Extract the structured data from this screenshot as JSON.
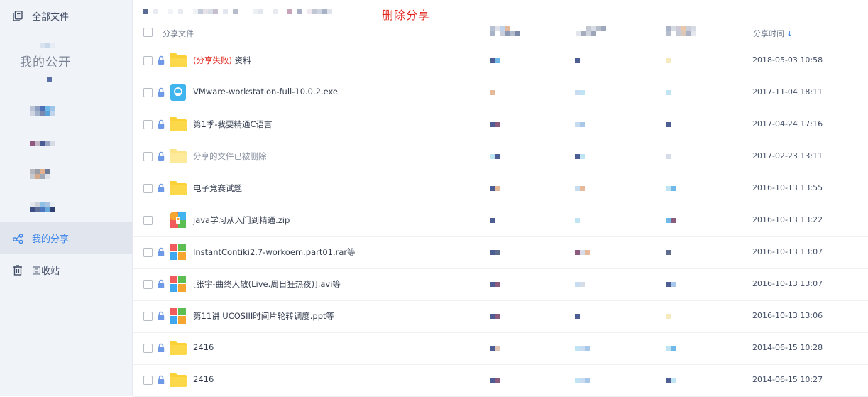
{
  "sidebar": {
    "items": [
      {
        "label": "全部文件",
        "icon": "files-icon"
      },
      {
        "label": "我的分享",
        "icon": "share-icon",
        "active": true
      },
      {
        "label": "回收站",
        "icon": "trash-icon"
      }
    ],
    "sub_label": "我的公开"
  },
  "toolbar": {
    "delete_share_label": "删除分享"
  },
  "table": {
    "headers": {
      "name": "分享文件",
      "time": "分享时间",
      "sort_arrow": "↓"
    },
    "rows": [
      {
        "fail_tag": "(分享失败)",
        "name": "资料",
        "time": "2018-05-03 10:58",
        "type": "folder",
        "dim": false
      },
      {
        "fail_tag": "",
        "name": "VMware-workstation-full-10.0.2.exe",
        "time": "2017-11-04 18:11",
        "type": "exe",
        "dim": false
      },
      {
        "fail_tag": "",
        "name": "第1季-我要精通C语言",
        "time": "2017-04-24 17:16",
        "type": "folder",
        "dim": false
      },
      {
        "fail_tag": "",
        "name": "分享的文件已被删除",
        "time": "2017-02-23 13:11",
        "type": "folder-dim",
        "dim": true
      },
      {
        "fail_tag": "",
        "name": "电子竞赛试题",
        "time": "2016-10-13 13:55",
        "type": "folder",
        "dim": false
      },
      {
        "fail_tag": "",
        "name": "java学习从入门到精通.zip",
        "time": "2016-10-13 13:22",
        "type": "zip",
        "dim": false
      },
      {
        "fail_tag": "",
        "name": "InstantContiki2.7-workoem.part01.rar等",
        "time": "2016-10-13 13:07",
        "type": "multi",
        "dim": false
      },
      {
        "fail_tag": "",
        "name": "[张宇-曲终人散(Live.周日狂热夜)].avi等",
        "time": "2016-10-13 13:07",
        "type": "multi",
        "dim": false
      },
      {
        "fail_tag": "",
        "name": "第11讲 UCOSIII时间片轮转调度.ppt等",
        "time": "2016-10-13 13:06",
        "type": "multi",
        "dim": false
      },
      {
        "fail_tag": "",
        "name": "2416",
        "time": "2014-06-15 10:28",
        "type": "folder",
        "dim": false
      },
      {
        "fail_tag": "",
        "name": "2416",
        "time": "2014-06-15 10:27",
        "type": "folder",
        "dim": false
      }
    ]
  },
  "colors": {
    "accent": "#3b84e8",
    "danger": "#e0251c",
    "folder": "#fbd235",
    "sidebar_bg": "#f0f3f8"
  }
}
